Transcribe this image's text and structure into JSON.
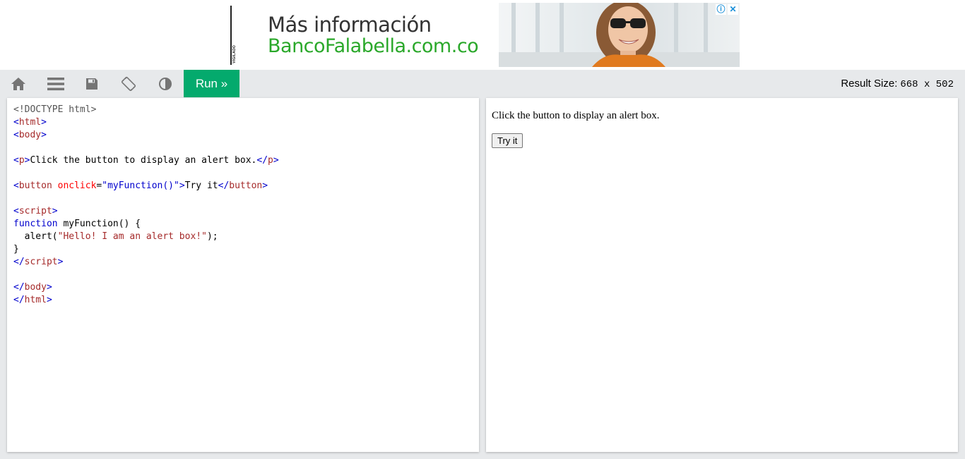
{
  "ad": {
    "line1": "Más información",
    "line2": "BancoFalabella.com.co",
    "vertical_text": "VIGILADO",
    "info_icon": "info-icon",
    "close_icon": "close-icon"
  },
  "toolbar": {
    "icons": [
      "home-icon",
      "menu-icon",
      "save-icon",
      "rotate-icon",
      "contrast-icon"
    ],
    "run_label": "Run »",
    "result_size_label": "Result Size:",
    "result_size_value": "668 x 502"
  },
  "code": [
    [
      {
        "t": "<!DOCTYPE html>",
        "c": "doctype"
      }
    ],
    [
      {
        "t": "<",
        "c": "tag"
      },
      {
        "t": "html",
        "c": "tagname"
      },
      {
        "t": ">",
        "c": "tag"
      }
    ],
    [
      {
        "t": "<",
        "c": "tag"
      },
      {
        "t": "body",
        "c": "tagname"
      },
      {
        "t": ">",
        "c": "tag"
      }
    ],
    [],
    [
      {
        "t": "<",
        "c": "tag"
      },
      {
        "t": "p",
        "c": "tagname"
      },
      {
        "t": ">",
        "c": "tag"
      },
      {
        "t": "Click the button to display an alert box.",
        "c": "text"
      },
      {
        "t": "</",
        "c": "tag"
      },
      {
        "t": "p",
        "c": "tagname"
      },
      {
        "t": ">",
        "c": "tag"
      }
    ],
    [],
    [
      {
        "t": "<",
        "c": "tag"
      },
      {
        "t": "button",
        "c": "tagname"
      },
      {
        "t": " onclick",
        "c": "attr"
      },
      {
        "t": "=",
        "c": "text"
      },
      {
        "t": "\"myFunction()\"",
        "c": "val"
      },
      {
        "t": ">",
        "c": "tag"
      },
      {
        "t": "Try it",
        "c": "text"
      },
      {
        "t": "</",
        "c": "tag"
      },
      {
        "t": "button",
        "c": "tagname"
      },
      {
        "t": ">",
        "c": "tag"
      }
    ],
    [],
    [
      {
        "t": "<",
        "c": "tag"
      },
      {
        "t": "script",
        "c": "tagname"
      },
      {
        "t": ">",
        "c": "tag"
      }
    ],
    [
      {
        "t": "function",
        "c": "kw"
      },
      {
        "t": " myFunction() {",
        "c": "text"
      }
    ],
    [
      {
        "t": "  alert(",
        "c": "text"
      },
      {
        "t": "\"Hello! I am an alert box!\"",
        "c": "str"
      },
      {
        "t": ");",
        "c": "text"
      }
    ],
    [
      {
        "t": "}",
        "c": "text"
      }
    ],
    [
      {
        "t": "</",
        "c": "tag"
      },
      {
        "t": "script",
        "c": "tagname"
      },
      {
        "t": ">",
        "c": "tag"
      }
    ],
    [],
    [
      {
        "t": "</",
        "c": "tag"
      },
      {
        "t": "body",
        "c": "tagname"
      },
      {
        "t": ">",
        "c": "tag"
      }
    ],
    [
      {
        "t": "</",
        "c": "tag"
      },
      {
        "t": "html",
        "c": "tagname"
      },
      {
        "t": ">",
        "c": "tag"
      }
    ]
  ],
  "result": {
    "paragraph": "Click the button to display an alert box.",
    "button_label": "Try it"
  },
  "colors": {
    "run_green": "#04aa6d",
    "toolbar_bg": "#e7e9eb",
    "ad_green": "#2aa82a",
    "icon_gray": "#757575"
  }
}
